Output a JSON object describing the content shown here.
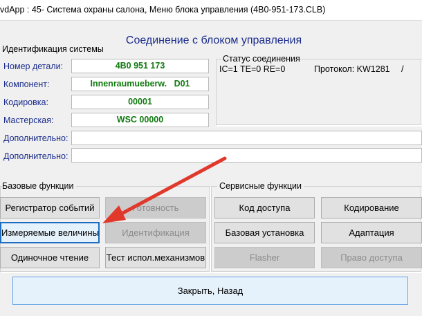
{
  "window": {
    "title": "vdApp : 45- Система охраны салона,  Меню блока управления (4B0-951-173.CLB)"
  },
  "heading": "Соединение с блоком управления",
  "system_id": {
    "group_label": "Идентификация системы",
    "fields": [
      {
        "label": "Номер детали:",
        "value": "4B0 951 173"
      },
      {
        "label": "Компонент:",
        "value": "Innenraumueberw.   D01"
      },
      {
        "label": "Кодировка:",
        "value": "00001"
      },
      {
        "label": "Мастерская:",
        "value": "WSC 00000"
      },
      {
        "label": "Дополнительно:",
        "value": ""
      },
      {
        "label": "Дополнительно:",
        "value": ""
      }
    ]
  },
  "connection": {
    "title": "Статус соединения",
    "status": "IC=1  TE=0   RE=0",
    "protocol": "Протокол: KW1281",
    "indicator": "/"
  },
  "basic_functions": {
    "group_label": "Базовые функции",
    "buttons": [
      {
        "label": "Регистратор событий",
        "enabled": true
      },
      {
        "label": "Готовность",
        "enabled": false
      },
      {
        "label": "Измеряемые величины",
        "enabled": true,
        "focused": true
      },
      {
        "label": "Идентификация",
        "enabled": false
      },
      {
        "label": "Одиночное чтение",
        "enabled": true
      },
      {
        "label": "Тест испол.механизмов",
        "enabled": true
      }
    ]
  },
  "service_functions": {
    "group_label": "Сервисные функции",
    "buttons": [
      {
        "label": "Код доступа",
        "enabled": true
      },
      {
        "label": "Кодирование",
        "enabled": true
      },
      {
        "label": "Базовая установка",
        "enabled": true
      },
      {
        "label": "Адаптация",
        "enabled": true
      },
      {
        "label": "Flasher",
        "enabled": false
      },
      {
        "label": "Право доступа",
        "enabled": false
      }
    ]
  },
  "close_button": "Закрыть, Назад",
  "colors": {
    "label_blue": "#1a2b8c",
    "value_green": "#117a11",
    "arrow_red": "#e0392b"
  }
}
